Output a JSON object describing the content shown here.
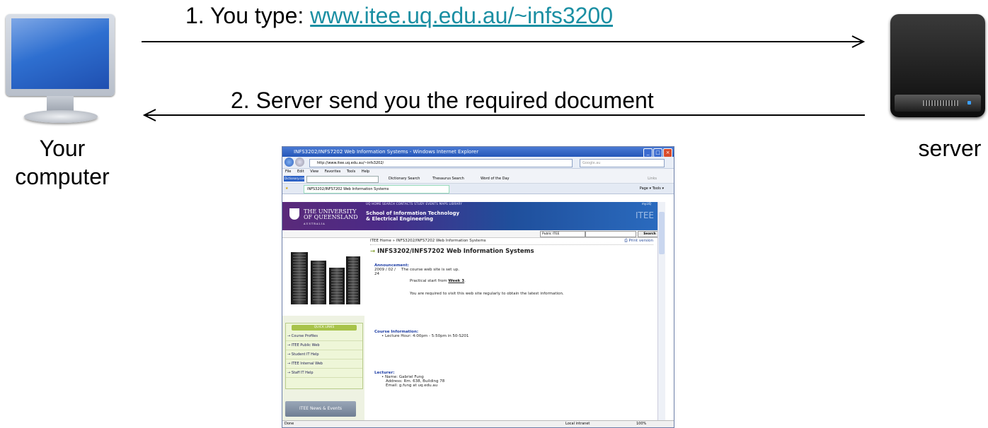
{
  "diagram": {
    "step1_prefix": "1. You type: ",
    "step1_url": "www.itee.uq.edu.au/~infs3200",
    "step2": "2. Server send you the required document",
    "client_label_1": "Your",
    "client_label_2": "computer",
    "server_label": "server"
  },
  "icons": {
    "client": "desktop-computer-icon",
    "server": "server-icon"
  },
  "colors": {
    "url": "#1b8fa3",
    "arrow": "#000000"
  },
  "browser": {
    "window_title": "INFS3202/INFS7202 Web Information Systems - Windows Internet Explorer",
    "address": "http://www.itee.uq.edu.au/~infs3202/",
    "search_placeholder": "Google.au",
    "menu": [
      "File",
      "Edit",
      "View",
      "Favorites",
      "Tools",
      "Help"
    ],
    "links_bar": {
      "dictionary": "Dictionary.com",
      "items": [
        "Dictionary Search",
        "Thesaurus Search",
        "Word of the Day"
      ],
      "links": "Links"
    },
    "tab_title": "INFS3202/INFS7202 Web Information Systems",
    "tab_tools": "Page ▾  Tools ▾",
    "site": {
      "nav": "UQ HOME   SEARCH   CONTACTS   STUDY   EVENTS   MAPS   LIBRARY",
      "myuq": "my.UQ",
      "uni_line1": "THE UNIVERSITY",
      "uni_line2": "OF QUEENSLAND",
      "uni_line3": "AUSTRALIA",
      "school_line1": "School of Information Technology",
      "school_line2": "& Electrical Engineering",
      "itee": "ITEE",
      "scope": "Public ITEE",
      "search_button": "Search",
      "breadcrumb": "ITEE Home » INFS3202/INFS7202 Web Information Systems",
      "print": "Print version",
      "heading": "INFS3202/INFS7202 Web Information Systems",
      "announcement_title": "Announcement:",
      "announcement_date": "2009 / 02 / 24",
      "announcement_1": "The course web site is set up.",
      "announcement_2_prefix": "Practical start from ",
      "announcement_2_link": "Week 3",
      "announcement_3": "You are required to visit this web site regularly to obtain the latest information.",
      "course_title": "Course Information:",
      "course_1": "Lecture Hour: 4:00pm - 5:50pm in 50-S201",
      "lecturer_title": "Lecturer:",
      "lecturer_name": "Name: Gabriel Fung",
      "lecturer_address": "Address: Rm. 638, Building 78",
      "lecturer_email": "Email: g.fung at uq.edu.au",
      "quick_links_title": "QUICK LINKS",
      "quick_links": [
        "Course Profiles",
        "ITEE Public Web",
        "Student IT Help",
        "ITEE Internal Web",
        "Staff IT Help"
      ],
      "news_button": "ITEE News & Events"
    },
    "status": {
      "left": "Done",
      "zone": "Local intranet",
      "zoom": "100%"
    }
  }
}
